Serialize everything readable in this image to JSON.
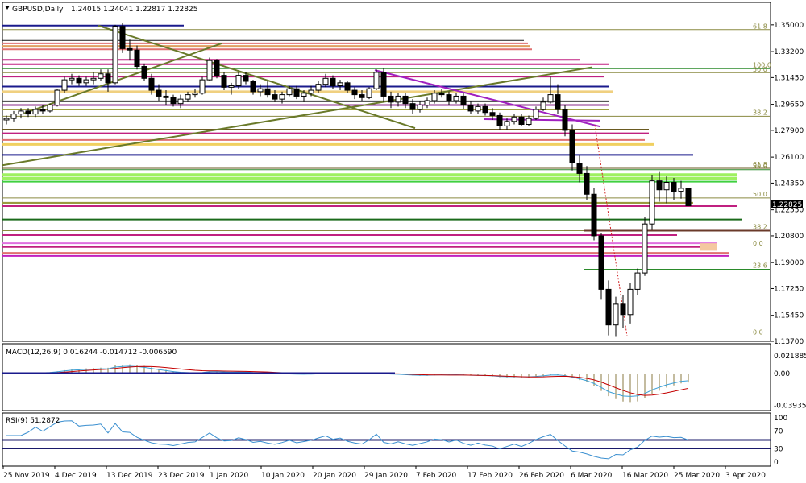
{
  "header": {
    "symbol": "GBPUSD,Daily",
    "ohlc": "1.24015 1.24041 1.22817 1.22825",
    "current_price": "1.22825"
  },
  "chart_data": [
    {
      "type": "candlestick",
      "title": "GBPUSD,Daily",
      "price_ticks": [
        "1.35000",
        "1.33200",
        "1.31450",
        "1.29650",
        "1.27900",
        "1.26100",
        "1.24350",
        "1.22550",
        "1.20800",
        "1.19000",
        "1.17250",
        "1.15450",
        "1.13700"
      ],
      "ylim": [
        1.137,
        1.351
      ],
      "x_labels": [
        "25 Nov 2019",
        "4 Dec 2019",
        "13 Dec 2019",
        "23 Dec 2019",
        "1 Jan 2020",
        "10 Jan 2020",
        "20 Jan 2020",
        "29 Jan 2020",
        "7 Feb 2020",
        "17 Feb 2020",
        "26 Feb 2020",
        "6 Mar 2020",
        "16 Mar 2020",
        "25 Mar 2020",
        "3 Apr 2020"
      ],
      "fib_labels": [
        {
          "text": "61.8",
          "price": 1.3465
        },
        {
          "text": "100.0",
          "price": 1.3205
        },
        {
          "text": "50.0",
          "price": 1.3175
        },
        {
          "text": "38.2",
          "price": 1.2885
        },
        {
          "text": "61.8",
          "price": 1.2535
        },
        {
          "text": "50.0",
          "price": 1.2525
        },
        {
          "text": "50.0",
          "price": 1.2335
        },
        {
          "text": "38.2",
          "price": 1.2115
        },
        {
          "text": "0.0",
          "price": 1.2005
        },
        {
          "text": "23.6",
          "price": 1.1855
        },
        {
          "text": "0.0",
          "price": 1.1405
        }
      ],
      "candles": [
        [
          1.286,
          1.289,
          1.283,
          1.287
        ],
        [
          1.287,
          1.292,
          1.285,
          1.29
        ],
        [
          1.29,
          1.294,
          1.287,
          1.292
        ],
        [
          1.292,
          1.294,
          1.288,
          1.29
        ],
        [
          1.29,
          1.295,
          1.288,
          1.293
        ],
        [
          1.293,
          1.296,
          1.29,
          1.292
        ],
        [
          1.292,
          1.297,
          1.291,
          1.296
        ],
        [
          1.296,
          1.307,
          1.295,
          1.306
        ],
        [
          1.306,
          1.315,
          1.304,
          1.313
        ],
        [
          1.313,
          1.317,
          1.31,
          1.314
        ],
        [
          1.314,
          1.316,
          1.309,
          1.311
        ],
        [
          1.311,
          1.315,
          1.309,
          1.313
        ],
        [
          1.313,
          1.318,
          1.31,
          1.314
        ],
        [
          1.314,
          1.32,
          1.312,
          1.317
        ],
        [
          1.317,
          1.32,
          1.305,
          1.311
        ],
        [
          1.311,
          1.35,
          1.31,
          1.349
        ],
        [
          1.349,
          1.351,
          1.331,
          1.334
        ],
        [
          1.334,
          1.34,
          1.326,
          1.333
        ],
        [
          1.333,
          1.336,
          1.32,
          1.322
        ],
        [
          1.322,
          1.324,
          1.312,
          1.314
        ],
        [
          1.314,
          1.317,
          1.303,
          1.306
        ],
        [
          1.306,
          1.31,
          1.299,
          1.302
        ],
        [
          1.302,
          1.306,
          1.296,
          1.301
        ],
        [
          1.301,
          1.303,
          1.295,
          1.297
        ],
        [
          1.297,
          1.303,
          1.294,
          1.3
        ],
        [
          1.3,
          1.305,
          1.298,
          1.303
        ],
        [
          1.303,
          1.307,
          1.301,
          1.304
        ],
        [
          1.304,
          1.315,
          1.303,
          1.313
        ],
        [
          1.313,
          1.328,
          1.312,
          1.326
        ],
        [
          1.326,
          1.327,
          1.314,
          1.316
        ],
        [
          1.316,
          1.318,
          1.306,
          1.308
        ],
        [
          1.308,
          1.311,
          1.303,
          1.309
        ],
        [
          1.309,
          1.318,
          1.307,
          1.316
        ],
        [
          1.316,
          1.318,
          1.31,
          1.312
        ],
        [
          1.312,
          1.313,
          1.303,
          1.305
        ],
        [
          1.305,
          1.31,
          1.302,
          1.307
        ],
        [
          1.307,
          1.312,
          1.301,
          1.303
        ],
        [
          1.303,
          1.306,
          1.298,
          1.3
        ],
        [
          1.3,
          1.305,
          1.297,
          1.303
        ],
        [
          1.303,
          1.309,
          1.302,
          1.307
        ],
        [
          1.307,
          1.309,
          1.3,
          1.302
        ],
        [
          1.302,
          1.306,
          1.298,
          1.304
        ],
        [
          1.304,
          1.309,
          1.302,
          1.306
        ],
        [
          1.306,
          1.312,
          1.304,
          1.31
        ],
        [
          1.31,
          1.317,
          1.308,
          1.314
        ],
        [
          1.314,
          1.316,
          1.307,
          1.309
        ],
        [
          1.309,
          1.313,
          1.306,
          1.311
        ],
        [
          1.311,
          1.312,
          1.304,
          1.306
        ],
        [
          1.306,
          1.308,
          1.3,
          1.303
        ],
        [
          1.303,
          1.306,
          1.299,
          1.301
        ],
        [
          1.301,
          1.308,
          1.3,
          1.307
        ],
        [
          1.307,
          1.32,
          1.306,
          1.318
        ],
        [
          1.318,
          1.321,
          1.298,
          1.302
        ],
        [
          1.302,
          1.305,
          1.294,
          1.298
        ],
        [
          1.298,
          1.304,
          1.295,
          1.302
        ],
        [
          1.302,
          1.304,
          1.294,
          1.297
        ],
        [
          1.297,
          1.3,
          1.29,
          1.293
        ],
        [
          1.293,
          1.299,
          1.291,
          1.296
        ],
        [
          1.296,
          1.301,
          1.294,
          1.299
        ],
        [
          1.299,
          1.306,
          1.297,
          1.304
        ],
        [
          1.304,
          1.307,
          1.301,
          1.303
        ],
        [
          1.303,
          1.305,
          1.296,
          1.299
        ],
        [
          1.299,
          1.304,
          1.297,
          1.302
        ],
        [
          1.302,
          1.304,
          1.293,
          1.296
        ],
        [
          1.296,
          1.299,
          1.29,
          1.292
        ],
        [
          1.292,
          1.297,
          1.29,
          1.295
        ],
        [
          1.295,
          1.297,
          1.289,
          1.291
        ],
        [
          1.291,
          1.294,
          1.286,
          1.289
        ],
        [
          1.289,
          1.291,
          1.279,
          1.282
        ],
        [
          1.282,
          1.287,
          1.279,
          1.285
        ],
        [
          1.285,
          1.29,
          1.283,
          1.288
        ],
        [
          1.288,
          1.29,
          1.282,
          1.283
        ],
        [
          1.283,
          1.289,
          1.282,
          1.287
        ],
        [
          1.287,
          1.295,
          1.286,
          1.293
        ],
        [
          1.293,
          1.301,
          1.292,
          1.298
        ],
        [
          1.298,
          1.315,
          1.297,
          1.303
        ],
        [
          1.303,
          1.31,
          1.29,
          1.293
        ],
        [
          1.293,
          1.296,
          1.275,
          1.279
        ],
        [
          1.279,
          1.283,
          1.252,
          1.257
        ],
        [
          1.257,
          1.262,
          1.244,
          1.25
        ],
        [
          1.25,
          1.255,
          1.232,
          1.236
        ],
        [
          1.236,
          1.24,
          1.205,
          1.208
        ],
        [
          1.208,
          1.21,
          1.165,
          1.172
        ],
        [
          1.172,
          1.178,
          1.141,
          1.148
        ],
        [
          1.148,
          1.167,
          1.14,
          1.162
        ],
        [
          1.162,
          1.168,
          1.146,
          1.155
        ],
        [
          1.155,
          1.176,
          1.149,
          1.172
        ],
        [
          1.172,
          1.186,
          1.168,
          1.183
        ],
        [
          1.183,
          1.221,
          1.181,
          1.216
        ],
        [
          1.216,
          1.249,
          1.212,
          1.245
        ],
        [
          1.245,
          1.251,
          1.231,
          1.239
        ],
        [
          1.239,
          1.248,
          1.23,
          1.244
        ],
        [
          1.244,
          1.247,
          1.232,
          1.238
        ],
        [
          1.238,
          1.245,
          1.233,
          1.24
        ],
        [
          1.24,
          1.2404,
          1.2282,
          1.2283
        ]
      ]
    },
    {
      "type": "line",
      "title": "MACD(12,26,9) 0.016244 -0.014712 -0.006590",
      "y_ticks": [
        "0.021885",
        "0.00",
        "-0.039351"
      ],
      "ylim": [
        -0.044,
        0.024
      ]
    },
    {
      "type": "line",
      "title": "RSI(9) 51.2872",
      "y_ticks": [
        "100",
        "70",
        "30",
        "0"
      ],
      "levels": [
        70,
        50,
        30
      ],
      "ylim": [
        0,
        100
      ]
    }
  ],
  "colors": {
    "up": "#ffffff",
    "down": "#000000",
    "macd_signal": "#c40000",
    "macd_line": "#3aa0d8",
    "rsi": "#3a8fd0",
    "price_box": "#000000"
  }
}
